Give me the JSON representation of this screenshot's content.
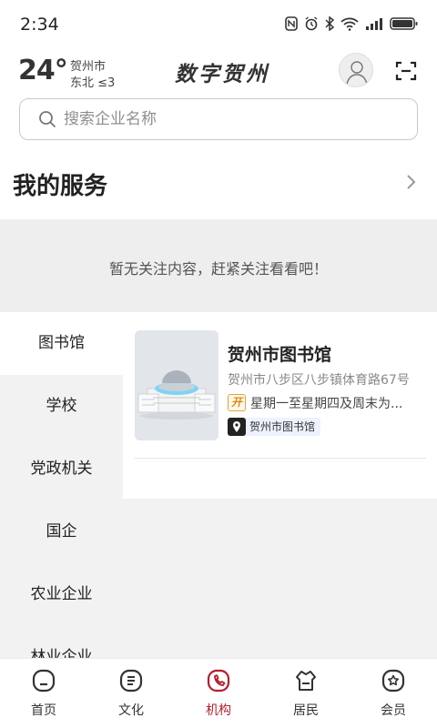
{
  "status_bar": {
    "time": "2:34"
  },
  "header": {
    "temperature": "24°",
    "city": "贺州市",
    "wind": "东北  ≤3",
    "app_title": "数字贺州"
  },
  "search": {
    "placeholder": "搜索企业名称",
    "value": ""
  },
  "services": {
    "title": "我的服务",
    "empty_text": "暂无关注内容，赶紧关注看看吧！"
  },
  "categories": [
    {
      "label": "图书馆",
      "active": true
    },
    {
      "label": "学校",
      "active": false
    },
    {
      "label": "党政机关",
      "active": false
    },
    {
      "label": "国企",
      "active": false
    },
    {
      "label": "农业企业",
      "active": false
    },
    {
      "label": "林业企业",
      "active": false
    }
  ],
  "listings": [
    {
      "name": "贺州市图书馆",
      "address": "贺州市八步区八步镇体育路67号",
      "open_badge": "开",
      "hours": "星期一至星期四及周末为...",
      "location_tag": "贺州市图书馆"
    }
  ],
  "bottom_nav": [
    {
      "label": "首页",
      "icon": "home-icon",
      "active": false
    },
    {
      "label": "文化",
      "icon": "culture-icon",
      "active": false
    },
    {
      "label": "机构",
      "icon": "institution-icon",
      "active": true
    },
    {
      "label": "居民",
      "icon": "resident-icon",
      "active": false
    },
    {
      "label": "会员",
      "icon": "member-icon",
      "active": false
    }
  ],
  "colors": {
    "accent": "#b41f2c",
    "divider_bg": "#eeeeee",
    "badge": "#d88a10"
  }
}
